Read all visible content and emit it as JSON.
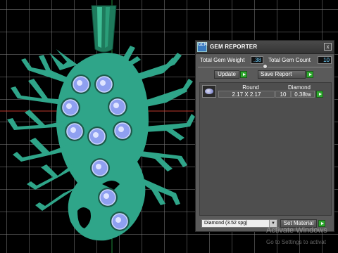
{
  "panel": {
    "title": "GEM REPORTER",
    "logo_text": "GEM",
    "close_symbol": "x",
    "total_gem_weight_label": "Total Gem Weight",
    "total_gem_weight_value": ".38",
    "total_gem_count_label": "Total Gem Count",
    "total_gem_count_value": "10",
    "update_label": "Update",
    "save_report_label": "Save Report",
    "slider_level": 0.5,
    "table": {
      "header_shape": "Round",
      "header_material": "Diamond",
      "rows": [
        {
          "size": "2.17 X 2.17",
          "count": "10",
          "weight": "0.38tw"
        }
      ]
    },
    "material_select": "Diamond    (3.52 spg)",
    "set_material_label": "Set Material"
  },
  "watermark": {
    "line1": "Activate Windows",
    "line2": "Go to Settings to activat"
  },
  "colors": {
    "accent_green": "#2fa82f",
    "pendant": "#2fa589",
    "gem": "#8fa0f0",
    "panel_bg": "#5a5a5a"
  }
}
